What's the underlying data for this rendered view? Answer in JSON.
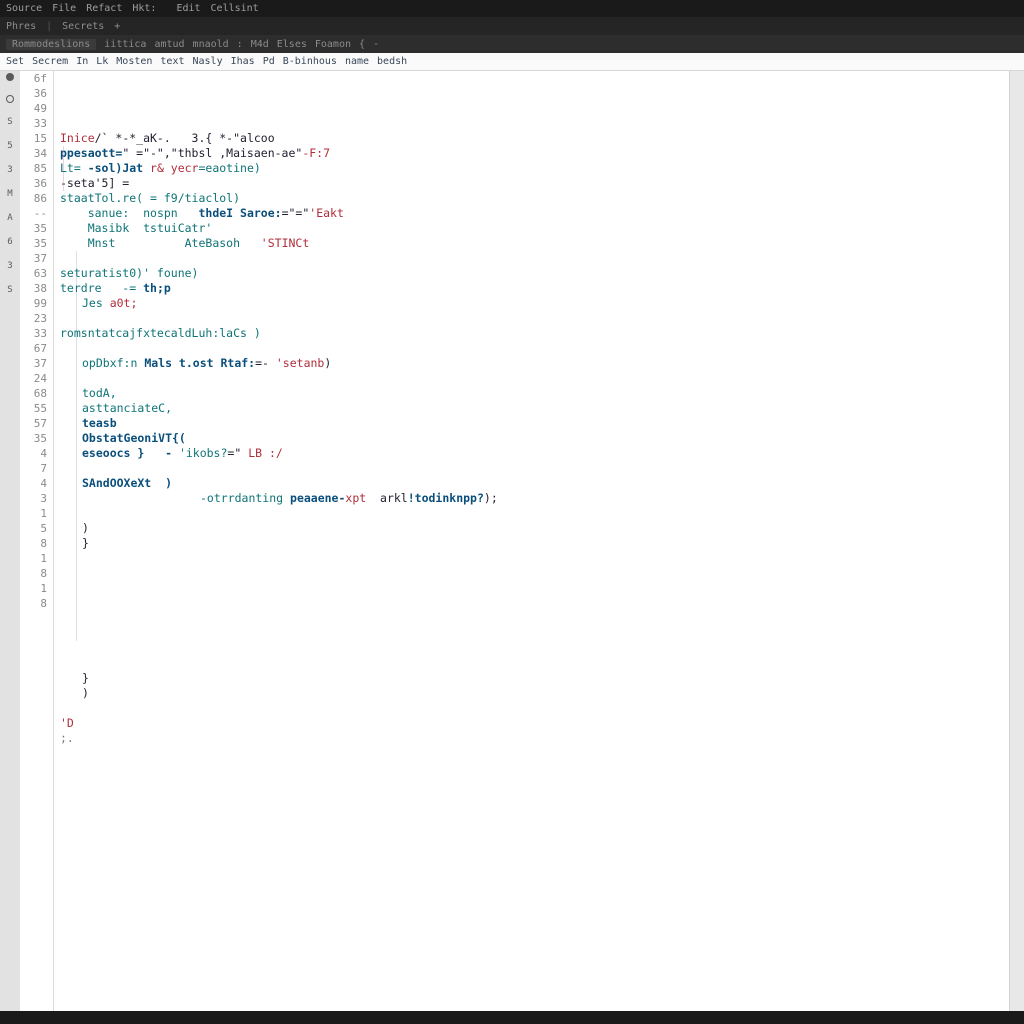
{
  "menu": {
    "items": [
      "Source",
      "File",
      "Refact",
      "Hkt:",
      "",
      "Edit",
      "Cellsint"
    ]
  },
  "tabs": {
    "items": [
      "Phres",
      "Secrets",
      "+"
    ]
  },
  "breadcrumb": {
    "head": "Rommodeslions",
    "items": [
      "iittica",
      "amtud",
      "mnaold",
      "",
      "M4d",
      "Elses",
      "Foamon",
      "{",
      "-"
    ]
  },
  "toolrow": {
    "items": [
      "Set",
      "Secrem",
      "In",
      "Lk",
      "Mosten",
      "text",
      "Nasly",
      "Ihas",
      "Pd",
      "B-binhous",
      "name",
      "bedsh"
    ]
  },
  "activity": {
    "items": [
      "●",
      "○",
      "S",
      "5",
      "3",
      "M",
      "A",
      "6",
      "3",
      "S"
    ]
  },
  "gutter": [
    "",
    "",
    "6f",
    "36",
    "49",
    "33",
    "15",
    "34",
    "85",
    "36",
    "86",
    "--",
    "35",
    "35",
    "37",
    "63",
    "38",
    "99",
    "23",
    "33",
    "67",
    "37",
    "24",
    "68",
    "55",
    "57",
    "35",
    "4",
    "7",
    "4",
    "3",
    "1",
    "5",
    "8",
    "1",
    "8",
    "1",
    "8",
    "",
    ""
  ],
  "code": [
    {
      "ind": 0,
      "spans": [
        {
          "c": "red",
          "t": "Inice"
        },
        {
          "c": "",
          "t": "/` *-*_aK-.   3.{ *-\"alcoo"
        }
      ]
    },
    {
      "ind": 0,
      "spans": [
        {
          "c": "kw",
          "t": "ppesaott="
        },
        {
          "c": "",
          "t": "\" =\"-\",\"thbsl ,Maisaen-ae\""
        },
        {
          "c": "red",
          "t": "-F:7"
        }
      ]
    },
    {
      "ind": 0,
      "spans": [
        {
          "c": "teal",
          "t": "Lt= "
        },
        {
          "c": "kw",
          "t": "-sol)Jat "
        },
        {
          "c": "red",
          "t": "r& yecr"
        },
        {
          "c": "teal",
          "t": "=eaotine)"
        }
      ]
    },
    {
      "ind": 0,
      "spans": [
        {
          "c": "",
          "t": "-seta'5] ="
        }
      ]
    },
    {
      "ind": 0,
      "spans": [
        {
          "c": "teal",
          "t": "staatTol.re( = f9/tiaclol)"
        }
      ]
    },
    {
      "ind": 0,
      "spans": [
        {
          "c": "",
          "t": "    "
        },
        {
          "c": "teal",
          "t": "sanue:  nospn   "
        },
        {
          "c": "kw",
          "t": "thdeI Saroe:"
        },
        {
          "c": "",
          "t": "=\"=\""
        },
        {
          "c": "red",
          "t": "'Eakt"
        }
      ]
    },
    {
      "ind": 0,
      "spans": [
        {
          "c": "",
          "t": "    "
        },
        {
          "c": "teal",
          "t": "Masibk  tstuiCatr'"
        }
      ]
    },
    {
      "ind": 0,
      "spans": [
        {
          "c": "",
          "t": "    "
        },
        {
          "c": "teal",
          "t": "Mnst          AteBasoh   "
        },
        {
          "c": "red",
          "t": "'STINCt"
        }
      ]
    },
    {
      "ind": 0,
      "spans": [
        {
          "c": "",
          "t": ""
        }
      ]
    },
    {
      "ind": 0,
      "spans": [
        {
          "c": "teal",
          "t": "seturatist0)' foune)"
        }
      ]
    },
    {
      "ind": 0,
      "spans": [
        {
          "c": "teal",
          "t": "terdre   -= "
        },
        {
          "c": "kw",
          "t": "th;p"
        }
      ]
    },
    {
      "ind": 1,
      "spans": [
        {
          "c": "teal",
          "t": "Jes "
        },
        {
          "c": "red",
          "t": "a0t;"
        }
      ]
    },
    {
      "ind": 0,
      "spans": [
        {
          "c": "",
          "t": ""
        }
      ]
    },
    {
      "ind": 0,
      "spans": [
        {
          "c": "teal",
          "t": "romsntatcajfxtecaldLuh:laCs )"
        }
      ]
    },
    {
      "ind": 0,
      "spans": [
        {
          "c": "",
          "t": ""
        }
      ]
    },
    {
      "ind": 1,
      "spans": [
        {
          "c": "teal",
          "t": "opDbxf:n "
        },
        {
          "c": "kw",
          "t": "Mals t.ost Rtaf:"
        },
        {
          "c": "",
          "t": "=- "
        },
        {
          "c": "red",
          "t": "'setanb"
        },
        {
          "c": "",
          "t": ")"
        }
      ]
    },
    {
      "ind": 0,
      "spans": [
        {
          "c": "",
          "t": ""
        }
      ]
    },
    {
      "ind": 1,
      "spans": [
        {
          "c": "teal",
          "t": "todA,"
        }
      ]
    },
    {
      "ind": 1,
      "spans": [
        {
          "c": "teal",
          "t": "asttanciateC,"
        }
      ]
    },
    {
      "ind": 1,
      "spans": [
        {
          "c": "kw",
          "t": "teasb"
        }
      ]
    },
    {
      "ind": 1,
      "spans": [
        {
          "c": "fn",
          "t": "ObstatGeoniVT{("
        }
      ]
    },
    {
      "ind": 1,
      "spans": [
        {
          "c": "kw",
          "t": "eseoocs }   - "
        },
        {
          "c": "teal",
          "t": "'ikobs?"
        },
        {
          "c": "",
          "t": "=\" "
        },
        {
          "c": "red",
          "t": "LB :/"
        }
      ]
    },
    {
      "ind": 0,
      "spans": [
        {
          "c": "",
          "t": ""
        }
      ]
    },
    {
      "ind": 1,
      "spans": [
        {
          "c": "fn",
          "t": "SAndOOXeXt  )"
        }
      ]
    },
    {
      "ind": 4,
      "spans": [
        {
          "c": "teal",
          "t": "-otrrdanting "
        },
        {
          "c": "kw",
          "t": "peaaene-"
        },
        {
          "c": "red",
          "t": "xpt"
        },
        {
          "c": "",
          "t": "  arkl"
        },
        {
          "c": "kw",
          "t": "!todinknpp?"
        },
        {
          "c": "",
          "t": ");"
        }
      ]
    },
    {
      "ind": 0,
      "spans": [
        {
          "c": "",
          "t": ""
        }
      ]
    },
    {
      "ind": 1,
      "spans": [
        {
          "c": "",
          "t": ")"
        }
      ]
    },
    {
      "ind": 1,
      "spans": [
        {
          "c": "",
          "t": "}"
        }
      ]
    },
    {
      "ind": 0,
      "spans": [
        {
          "c": "",
          "t": ""
        }
      ]
    },
    {
      "ind": 0,
      "spans": [
        {
          "c": "",
          "t": ""
        }
      ]
    },
    {
      "ind": 0,
      "spans": [
        {
          "c": "",
          "t": ""
        }
      ]
    },
    {
      "ind": 0,
      "spans": [
        {
          "c": "",
          "t": ""
        }
      ]
    },
    {
      "ind": 0,
      "spans": [
        {
          "c": "",
          "t": ""
        }
      ]
    },
    {
      "ind": 0,
      "spans": [
        {
          "c": "",
          "t": ""
        }
      ]
    },
    {
      "ind": 0,
      "spans": [
        {
          "c": "",
          "t": ""
        }
      ]
    },
    {
      "ind": 0,
      "spans": [
        {
          "c": "",
          "t": ""
        }
      ]
    },
    {
      "ind": 1,
      "spans": [
        {
          "c": "",
          "t": "}"
        }
      ]
    },
    {
      "ind": 1,
      "spans": [
        {
          "c": "",
          "t": ")"
        }
      ]
    },
    {
      "ind": 0,
      "spans": [
        {
          "c": "",
          "t": ""
        }
      ]
    },
    {
      "ind": 0,
      "spans": [
        {
          "c": "red",
          "t": "'D"
        }
      ]
    },
    {
      "ind": 0,
      "spans": [
        {
          "c": "cm",
          "t": ";."
        }
      ]
    }
  ]
}
